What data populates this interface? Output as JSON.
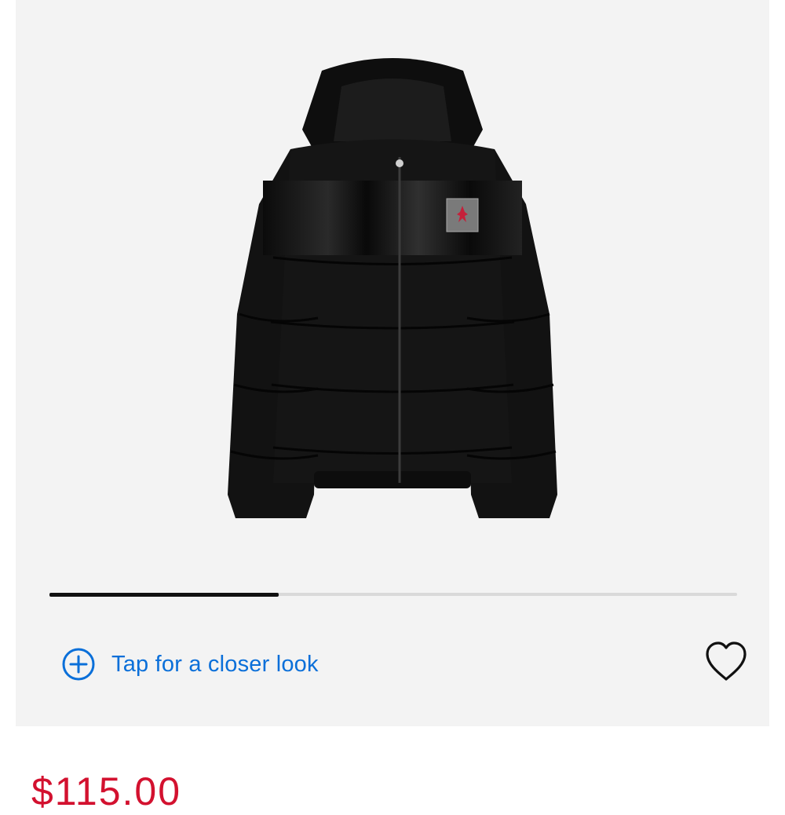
{
  "gallery": {
    "image_alt": "Black hooded puffer jacket with glossy chest panel and Jordan patch",
    "image_progress": 0.333,
    "zoom_label": "Tap for a closer look",
    "zoom_icon": "plus-circle-icon",
    "wishlist_icon": "heart-outline-icon"
  },
  "product": {
    "price": "$115.00"
  },
  "colors": {
    "accent_blue": "#0a6fd9",
    "price_red": "#d3112f",
    "gallery_bg": "#f3f3f3"
  }
}
